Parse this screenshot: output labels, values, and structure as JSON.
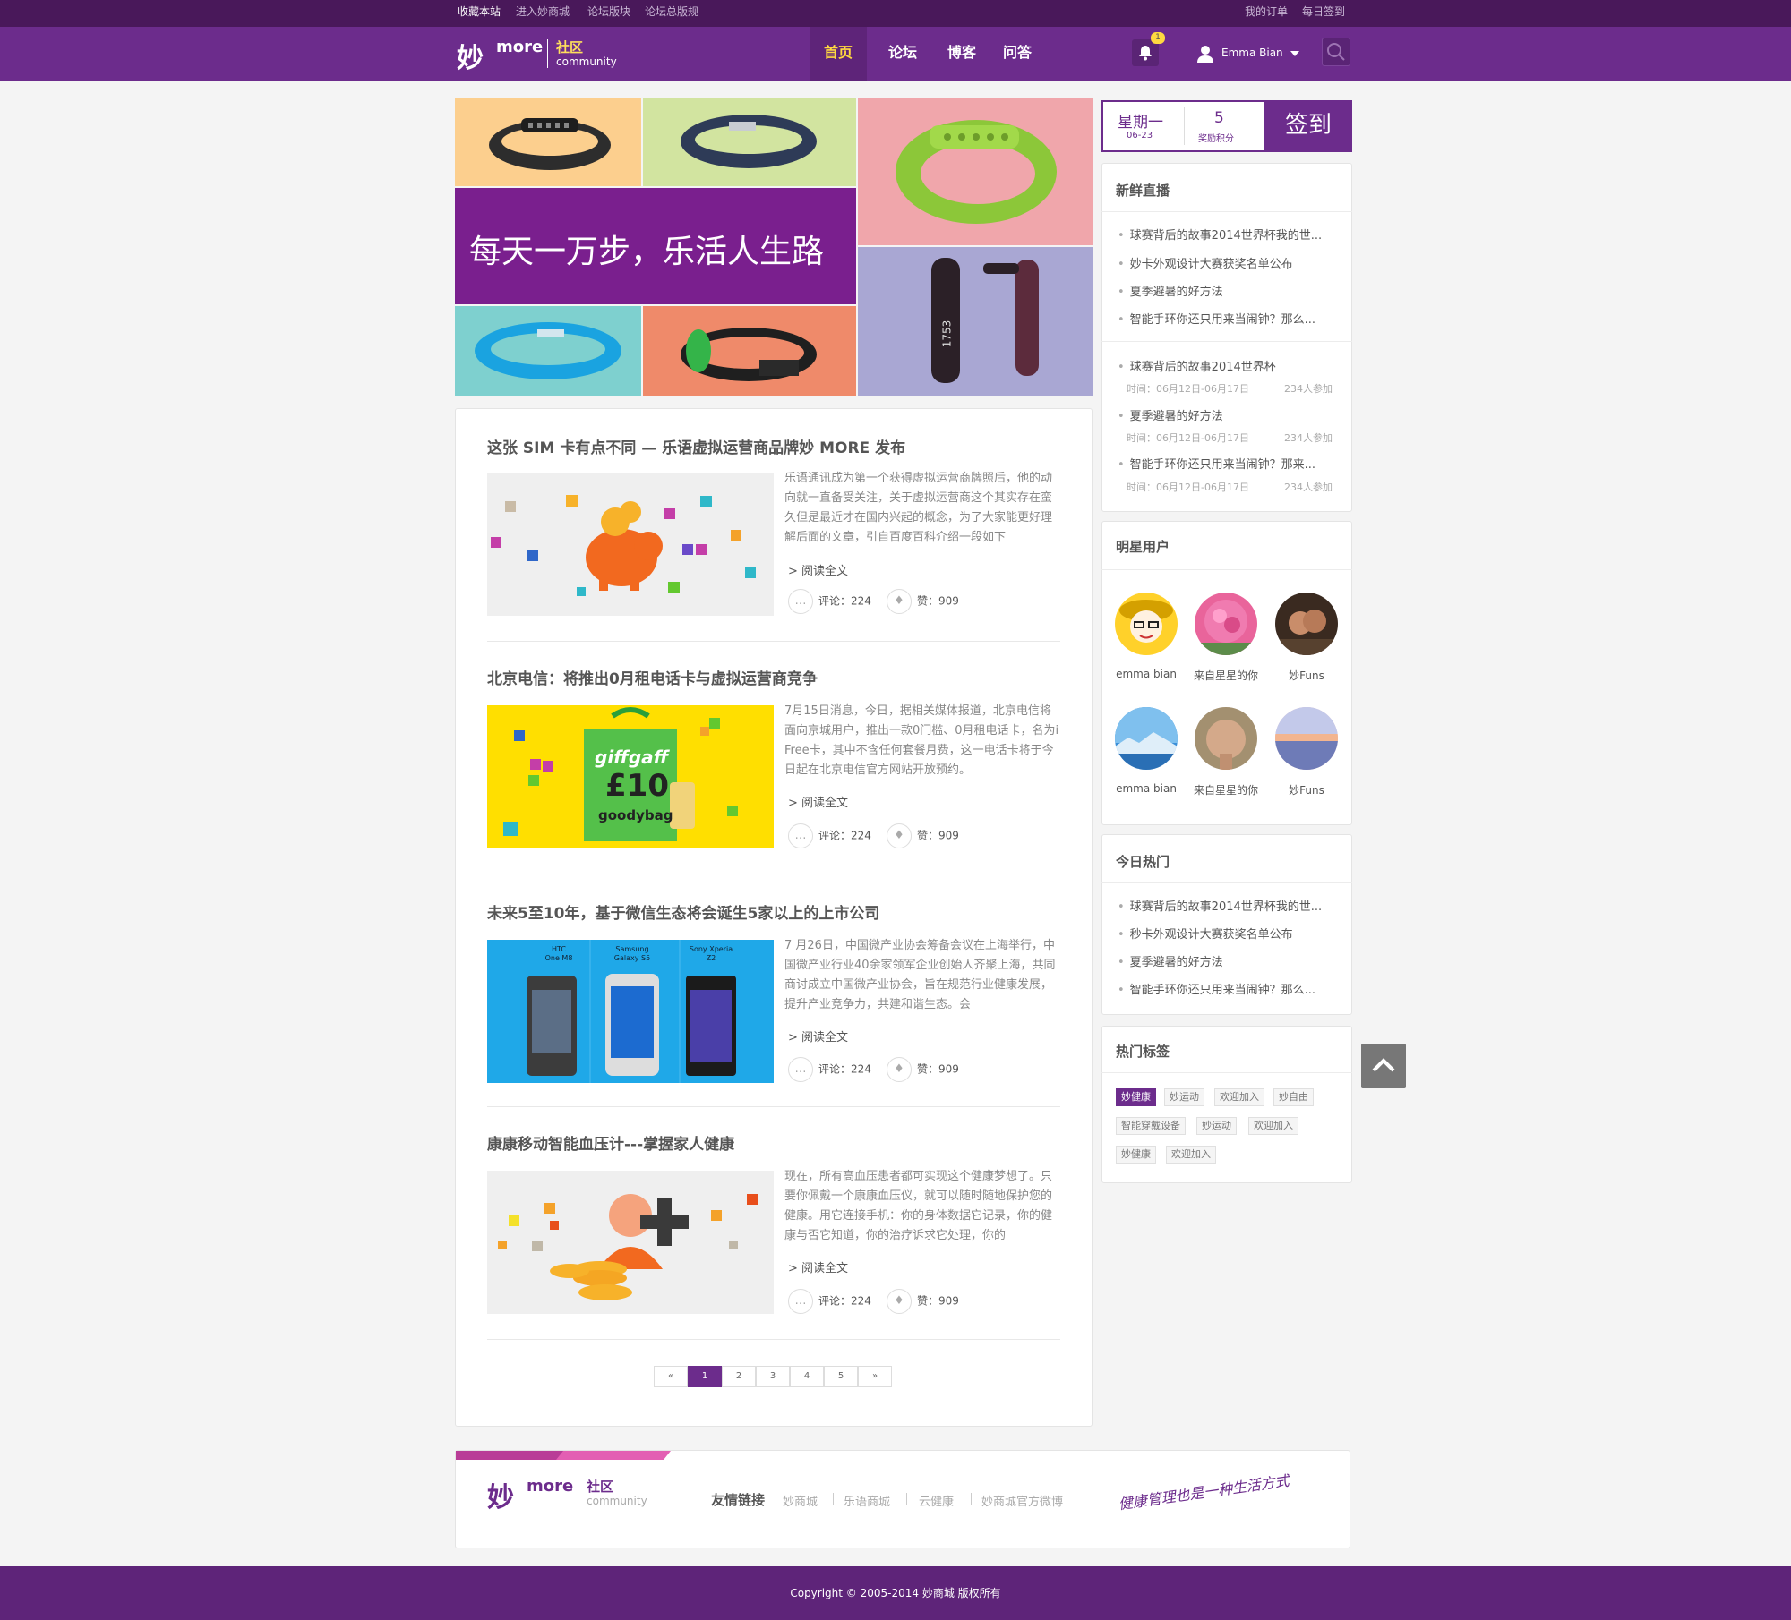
{
  "topbar": {
    "left_links": [
      "收藏本站",
      "进入妙商城",
      "论坛版块",
      "论坛总版规"
    ],
    "right_links": [
      "我的订单",
      "每日签到"
    ]
  },
  "header": {
    "logo_mark": "妙",
    "logo_more": "more",
    "logo_cn": "社区",
    "logo_en": "community",
    "nav": [
      "首页",
      "论坛",
      "博客",
      "问答"
    ],
    "notification_count": "1",
    "user_name": "Emma Bian"
  },
  "banner": {
    "headline": "每天一万步，乐活人生路",
    "device_text": "1753"
  },
  "articles": [
    {
      "title": "这张 SIM 卡有点不同 — 乐语虚拟运营商品牌妙 MORE 发布",
      "desc": "乐语通讯成为第一个获得虚拟运营商牌照后，他的动向就一直备受关注，关于虚拟运营商这个其实存在蛮久但是最近才在国内兴起的概念，为了大家能更好理解后面的文章，引自百度百科介绍一段如下",
      "read_more": "阅读全文",
      "comments": "评论：224",
      "likes": "赞：909"
    },
    {
      "title": "北京电信：将推出0月租电话卡与虚拟运营商竞争",
      "desc": "7月15日消息，今日，据相关媒体报道，北京电信将面向京城用户，推出一款0门槛、0月租电话卡，名为iFree卡，其中不含任何套餐月费，这一电话卡将于今日起在北京电信官方网站开放预约。",
      "read_more": "阅读全文",
      "comments": "评论：224",
      "likes": "赞：909",
      "image_text": {
        "brand": "giffgaff",
        "price": "£10",
        "sub": "goodybag"
      }
    },
    {
      "title": "未来5至10年，基于微信生态将会诞生5家以上的上市公司",
      "desc": "7 月26日，中国微产业协会筹备会议在上海举行，中国微产业行业40余家领军企业创始人齐聚上海，共同商讨成立中国微产业协会，旨在规范行业健康发展，提升产业竞争力，共建和谐生态。会",
      "read_more": "阅读全文",
      "comments": "评论：224",
      "likes": "赞：909",
      "phones": [
        {
          "line1": "HTC",
          "line2": "One M8"
        },
        {
          "line1": "Samsung",
          "line2": "Galaxy S5"
        },
        {
          "line1": "Sony Xperia",
          "line2": "Z2"
        }
      ]
    },
    {
      "title": "康康移动智能血压计---掌握家人健康",
      "desc": "现在，所有高血压患者都可实现这个健康梦想了。只要你佩戴一个康康血压仪，就可以随时随地保护您的健康。用它连接手机：你的身体数据它记录，你的健康与否它知道，你的治疗诉求它处理，你的",
      "read_more": "阅读全文",
      "comments": "评论：224",
      "likes": "赞：909"
    }
  ],
  "pagination": [
    "«",
    "1",
    "2",
    "3",
    "4",
    "5",
    "»"
  ],
  "checkin": {
    "weekday": "星期一",
    "date": "06-23",
    "points": "5",
    "points_label": "奖励积分",
    "button": "签到"
  },
  "live": {
    "title": "新鲜直播",
    "items": [
      "球赛背后的故事2014世界杯我的世...",
      "妙卡外观设计大赛获奖名单公布",
      "夏季避暑的好方法",
      "智能手环你还只用来当闹钟？那么..."
    ],
    "events": [
      {
        "title": "球赛背后的故事2014世界杯",
        "time": "时间：06月12日-06月17日",
        "count": "234人参加"
      },
      {
        "title": "夏季避暑的好方法",
        "time": "时间：06月12日-06月17日",
        "count": "234人参加"
      },
      {
        "title": "智能手环你还只用来当闹钟？那来...",
        "time": "时间：06月12日-06月17日",
        "count": "234人参加"
      }
    ]
  },
  "stars": {
    "title": "明星用户",
    "users": [
      "emma bian",
      "来自星星的你",
      "妙Funs",
      "emma bian",
      "来自星星的你",
      "妙Funs"
    ]
  },
  "hot": {
    "title": "今日热门",
    "items": [
      "球赛背后的故事2014世界杯我的世...",
      "秒卡外观设计大赛获奖名单公布",
      "夏季避暑的好方法",
      "智能手环你还只用来当闹钟？那么..."
    ]
  },
  "tags": {
    "title": "热门标签",
    "items": [
      "妙健康",
      "妙运动",
      "欢迎加入",
      "妙自由",
      "智能穿戴设备",
      "妙运动",
      "欢迎加入",
      "妙健康",
      "欢迎加入"
    ]
  },
  "footer": {
    "links_title": "友情链接",
    "links": [
      "妙商城",
      "乐语商城",
      "云健康",
      "妙商城官方微博"
    ],
    "slogan": "健康管理也是一种生活方式",
    "copyright": "Copyright © 2005-2014 妙商城 版权所有"
  },
  "colors": {
    "brand_purple": "#6c2c8c",
    "topbar": "#49185a",
    "accent_yellow": "#ffd940"
  }
}
